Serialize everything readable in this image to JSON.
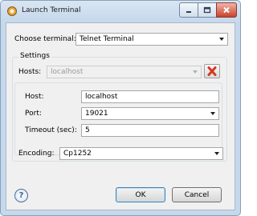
{
  "window": {
    "title": "Launch Terminal",
    "icons": {
      "app": "terminal-launch-icon",
      "minimize": "minimize-icon",
      "maximize": "maximize-icon",
      "close": "close-icon"
    }
  },
  "dialog": {
    "choose_terminal_label": "Choose terminal:",
    "choose_terminal_value": "Telnet Terminal",
    "settings_label": "Settings",
    "hosts_label": "Hosts:",
    "hosts_value": "localhost",
    "host_label": "Host:",
    "host_value": "localhost",
    "port_label": "Port:",
    "port_value": "19021",
    "timeout_label": "Timeout (sec):",
    "timeout_value": "5",
    "encoding_label": "Encoding:",
    "encoding_value": "Cp1252",
    "help_glyph": "?",
    "ok_label": "OK",
    "cancel_label": "Cancel"
  },
  "colors": {
    "delete_red": "#d33a22",
    "accent_blue": "#3c7fb1"
  }
}
